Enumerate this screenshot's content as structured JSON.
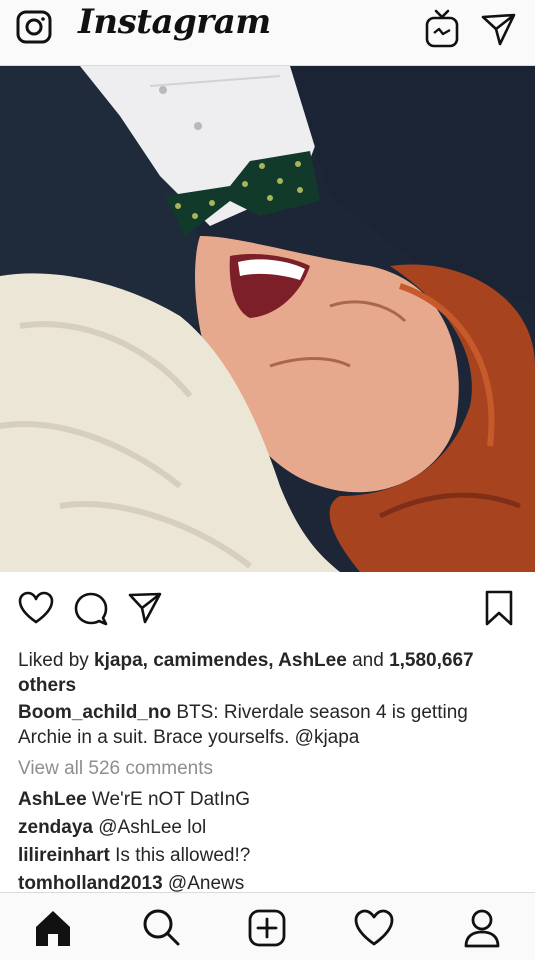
{
  "header": {
    "logo_text": "Instagram",
    "icons": [
      "camera-icon",
      "igtv-icon",
      "direct-message-icon"
    ]
  },
  "post": {
    "action_icons": [
      "heart-icon",
      "comment-icon",
      "share-icon",
      "bookmark-icon"
    ],
    "likes": {
      "prefix": "Liked by ",
      "names": "kjapa, camimendes, AshLee",
      "middle": " and ",
      "count": "1,580,667",
      "suffix": "others"
    },
    "caption": {
      "username": "Boom_achild_no",
      "text": " BTS: Riverdale season 4 is getting Archie in a suit. Brace yourselfs. @kjapa"
    },
    "view_all_comments": "View all 526 comments",
    "comments": [
      {
        "username": "AshLee",
        "text": " We'rE nOT DatInG"
      },
      {
        "username": "zendaya",
        "text": " @AshLee lol"
      },
      {
        "username": "lilireinhart",
        "text": " Is this allowed!?"
      },
      {
        "username": "tomholland2013",
        "text": " @Anews"
      }
    ]
  },
  "bottom_nav": [
    "home-icon",
    "search-icon",
    "new-post-icon",
    "activity-icon",
    "profile-icon"
  ],
  "colors": {
    "text": "#262626",
    "muted": "#8e8e8e",
    "bar": "#fafafa",
    "border": "#dbdbdb"
  }
}
